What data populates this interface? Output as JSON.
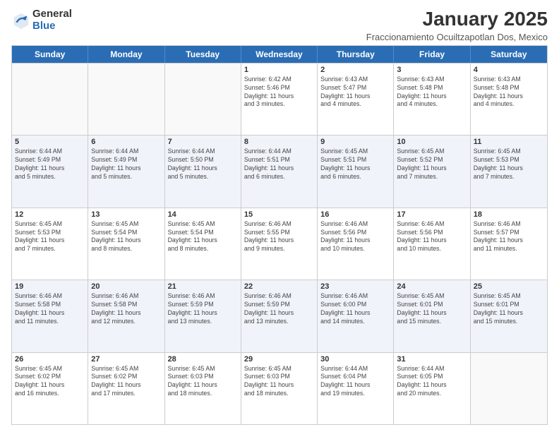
{
  "logo": {
    "general": "General",
    "blue": "Blue"
  },
  "header": {
    "month": "January 2025",
    "location": "Fraccionamiento Ocuiltzapotlan Dos, Mexico"
  },
  "days_of_week": [
    "Sunday",
    "Monday",
    "Tuesday",
    "Wednesday",
    "Thursday",
    "Friday",
    "Saturday"
  ],
  "weeks": [
    [
      {
        "day": "",
        "info": ""
      },
      {
        "day": "",
        "info": ""
      },
      {
        "day": "",
        "info": ""
      },
      {
        "day": "1",
        "info": "Sunrise: 6:42 AM\nSunset: 5:46 PM\nDaylight: 11 hours\nand 3 minutes."
      },
      {
        "day": "2",
        "info": "Sunrise: 6:43 AM\nSunset: 5:47 PM\nDaylight: 11 hours\nand 4 minutes."
      },
      {
        "day": "3",
        "info": "Sunrise: 6:43 AM\nSunset: 5:48 PM\nDaylight: 11 hours\nand 4 minutes."
      },
      {
        "day": "4",
        "info": "Sunrise: 6:43 AM\nSunset: 5:48 PM\nDaylight: 11 hours\nand 4 minutes."
      }
    ],
    [
      {
        "day": "5",
        "info": "Sunrise: 6:44 AM\nSunset: 5:49 PM\nDaylight: 11 hours\nand 5 minutes."
      },
      {
        "day": "6",
        "info": "Sunrise: 6:44 AM\nSunset: 5:49 PM\nDaylight: 11 hours\nand 5 minutes."
      },
      {
        "day": "7",
        "info": "Sunrise: 6:44 AM\nSunset: 5:50 PM\nDaylight: 11 hours\nand 5 minutes."
      },
      {
        "day": "8",
        "info": "Sunrise: 6:44 AM\nSunset: 5:51 PM\nDaylight: 11 hours\nand 6 minutes."
      },
      {
        "day": "9",
        "info": "Sunrise: 6:45 AM\nSunset: 5:51 PM\nDaylight: 11 hours\nand 6 minutes."
      },
      {
        "day": "10",
        "info": "Sunrise: 6:45 AM\nSunset: 5:52 PM\nDaylight: 11 hours\nand 7 minutes."
      },
      {
        "day": "11",
        "info": "Sunrise: 6:45 AM\nSunset: 5:53 PM\nDaylight: 11 hours\nand 7 minutes."
      }
    ],
    [
      {
        "day": "12",
        "info": "Sunrise: 6:45 AM\nSunset: 5:53 PM\nDaylight: 11 hours\nand 7 minutes."
      },
      {
        "day": "13",
        "info": "Sunrise: 6:45 AM\nSunset: 5:54 PM\nDaylight: 11 hours\nand 8 minutes."
      },
      {
        "day": "14",
        "info": "Sunrise: 6:45 AM\nSunset: 5:54 PM\nDaylight: 11 hours\nand 8 minutes."
      },
      {
        "day": "15",
        "info": "Sunrise: 6:46 AM\nSunset: 5:55 PM\nDaylight: 11 hours\nand 9 minutes."
      },
      {
        "day": "16",
        "info": "Sunrise: 6:46 AM\nSunset: 5:56 PM\nDaylight: 11 hours\nand 10 minutes."
      },
      {
        "day": "17",
        "info": "Sunrise: 6:46 AM\nSunset: 5:56 PM\nDaylight: 11 hours\nand 10 minutes."
      },
      {
        "day": "18",
        "info": "Sunrise: 6:46 AM\nSunset: 5:57 PM\nDaylight: 11 hours\nand 11 minutes."
      }
    ],
    [
      {
        "day": "19",
        "info": "Sunrise: 6:46 AM\nSunset: 5:58 PM\nDaylight: 11 hours\nand 11 minutes."
      },
      {
        "day": "20",
        "info": "Sunrise: 6:46 AM\nSunset: 5:58 PM\nDaylight: 11 hours\nand 12 minutes."
      },
      {
        "day": "21",
        "info": "Sunrise: 6:46 AM\nSunset: 5:59 PM\nDaylight: 11 hours\nand 13 minutes."
      },
      {
        "day": "22",
        "info": "Sunrise: 6:46 AM\nSunset: 5:59 PM\nDaylight: 11 hours\nand 13 minutes."
      },
      {
        "day": "23",
        "info": "Sunrise: 6:46 AM\nSunset: 6:00 PM\nDaylight: 11 hours\nand 14 minutes."
      },
      {
        "day": "24",
        "info": "Sunrise: 6:45 AM\nSunset: 6:01 PM\nDaylight: 11 hours\nand 15 minutes."
      },
      {
        "day": "25",
        "info": "Sunrise: 6:45 AM\nSunset: 6:01 PM\nDaylight: 11 hours\nand 15 minutes."
      }
    ],
    [
      {
        "day": "26",
        "info": "Sunrise: 6:45 AM\nSunset: 6:02 PM\nDaylight: 11 hours\nand 16 minutes."
      },
      {
        "day": "27",
        "info": "Sunrise: 6:45 AM\nSunset: 6:02 PM\nDaylight: 11 hours\nand 17 minutes."
      },
      {
        "day": "28",
        "info": "Sunrise: 6:45 AM\nSunset: 6:03 PM\nDaylight: 11 hours\nand 18 minutes."
      },
      {
        "day": "29",
        "info": "Sunrise: 6:45 AM\nSunset: 6:03 PM\nDaylight: 11 hours\nand 18 minutes."
      },
      {
        "day": "30",
        "info": "Sunrise: 6:44 AM\nSunset: 6:04 PM\nDaylight: 11 hours\nand 19 minutes."
      },
      {
        "day": "31",
        "info": "Sunrise: 6:44 AM\nSunset: 6:05 PM\nDaylight: 11 hours\nand 20 minutes."
      },
      {
        "day": "",
        "info": ""
      }
    ]
  ],
  "colors": {
    "header_bg": "#2a6db5",
    "alt_row_bg": "#e8eef8"
  }
}
